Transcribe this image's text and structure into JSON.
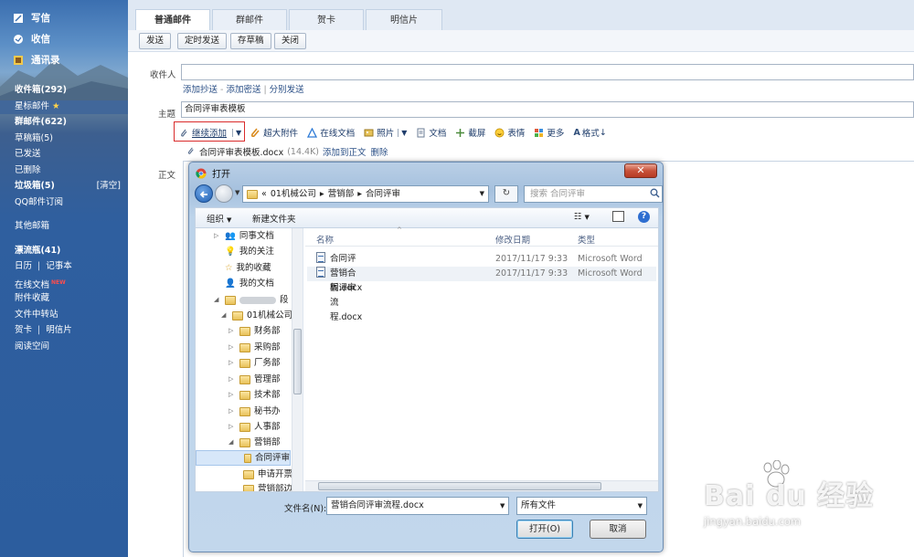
{
  "sidebar": {
    "compose": "写信",
    "inbox_receive": "收信",
    "contacts": "通讯录",
    "items": [
      {
        "label": "收件箱(292)"
      },
      {
        "label": "星标邮件"
      },
      {
        "label": "群邮件(622)"
      },
      {
        "label": "草稿箱(5)"
      },
      {
        "label": "已发送"
      },
      {
        "label": "已删除"
      },
      {
        "label": "垃圾箱(5)",
        "right": "[清空]"
      },
      {
        "label": "QQ邮件订阅"
      },
      {
        "label": "其他邮箱"
      },
      {
        "label": "漂流瓶(41)"
      },
      {
        "label": "日历",
        "second": "记事本"
      },
      {
        "label": "在线文档",
        "badge": "NEW"
      },
      {
        "label": "附件收藏"
      },
      {
        "label": "文件中转站"
      },
      {
        "label": "贺卡",
        "second": "明信片"
      },
      {
        "label": "阅读空间"
      }
    ]
  },
  "tabs": [
    "普通邮件",
    "群邮件",
    "贺卡",
    "明信片"
  ],
  "toolbar": {
    "send": "发送",
    "schedule": "定时发送",
    "draft": "存草稿",
    "close": "关闭"
  },
  "compose": {
    "to_label": "收件人",
    "to_value": "",
    "add_cc": "添加抄送",
    "add_bcc": "添加密送",
    "separate": "分别发送",
    "subject_label": "主题",
    "subject_value": "合同评审表模板",
    "body_label": "正文"
  },
  "attach_bar": {
    "continue_add": "继续添加",
    "big_attach": "超大附件",
    "online_doc": "在线文档",
    "photo": "照片",
    "doc": "文档",
    "screenshot": "截屏",
    "emoji": "表情",
    "more": "更多",
    "format": "格式"
  },
  "attachment": {
    "name": "合同评审表模板.docx",
    "size": "(14.4K)",
    "add_to_body": "添加到正文",
    "delete": "删除"
  },
  "dialog": {
    "title": "打开",
    "close": "✕",
    "path": [
      "«",
      "01机械公司",
      "营销部",
      "合同评审"
    ],
    "search_placeholder": "搜索 合同评审",
    "organize": "组织",
    "new_folder": "新建文件夹",
    "tree": [
      {
        "label": "同事文档"
      },
      {
        "label": "我的关注"
      },
      {
        "label": "我的收藏"
      },
      {
        "label": "我的文档"
      },
      {
        "label": "段"
      },
      {
        "label": "01机械公司"
      },
      {
        "label": "财务部"
      },
      {
        "label": "采购部"
      },
      {
        "label": "厂务部"
      },
      {
        "label": "管理部"
      },
      {
        "label": "技术部"
      },
      {
        "label": "秘书办"
      },
      {
        "label": "人事部"
      },
      {
        "label": "营销部"
      },
      {
        "label": "合同评审"
      },
      {
        "label": "申请开票"
      },
      {
        "label": "营销部边"
      }
    ],
    "columns": {
      "name": "名称",
      "date": "修改日期",
      "type": "类型"
    },
    "files": [
      {
        "name": "合同评审表模板.docx",
        "date": "2017/11/17 9:33",
        "type": "Microsoft Word"
      },
      {
        "name": "营销合同评审流程.docx",
        "date": "2017/11/17 9:33",
        "type": "Microsoft Word"
      }
    ],
    "filename_label": "文件名(N):",
    "filename_value": "营销合同评审流程.docx",
    "filetype_value": "所有文件",
    "open_btn": "打开(O)",
    "cancel_btn": "取消"
  },
  "watermark": {
    "text": "Bai du 经验",
    "url": "jingyan.baidu.com"
  },
  "colors": {
    "sidebar": "#2f5f9f",
    "accent_red": "#d92b2b",
    "link": "#2a4f86"
  }
}
